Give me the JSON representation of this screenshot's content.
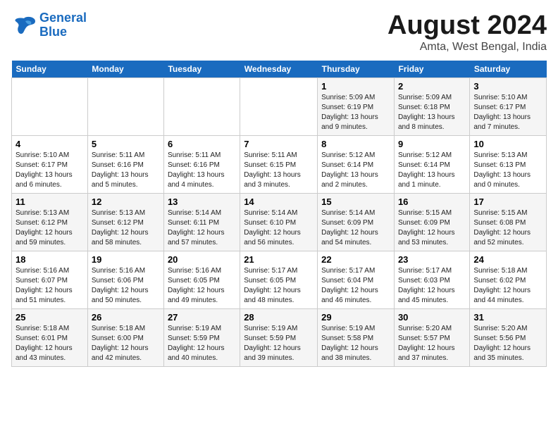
{
  "logo": {
    "line1": "General",
    "line2": "Blue"
  },
  "title": "August 2024",
  "subtitle": "Amta, West Bengal, India",
  "days_of_week": [
    "Sunday",
    "Monday",
    "Tuesday",
    "Wednesday",
    "Thursday",
    "Friday",
    "Saturday"
  ],
  "weeks": [
    [
      {
        "day": "",
        "info": ""
      },
      {
        "day": "",
        "info": ""
      },
      {
        "day": "",
        "info": ""
      },
      {
        "day": "",
        "info": ""
      },
      {
        "day": "1",
        "info": "Sunrise: 5:09 AM\nSunset: 6:19 PM\nDaylight: 13 hours\nand 9 minutes."
      },
      {
        "day": "2",
        "info": "Sunrise: 5:09 AM\nSunset: 6:18 PM\nDaylight: 13 hours\nand 8 minutes."
      },
      {
        "day": "3",
        "info": "Sunrise: 5:10 AM\nSunset: 6:17 PM\nDaylight: 13 hours\nand 7 minutes."
      }
    ],
    [
      {
        "day": "4",
        "info": "Sunrise: 5:10 AM\nSunset: 6:17 PM\nDaylight: 13 hours\nand 6 minutes."
      },
      {
        "day": "5",
        "info": "Sunrise: 5:11 AM\nSunset: 6:16 PM\nDaylight: 13 hours\nand 5 minutes."
      },
      {
        "day": "6",
        "info": "Sunrise: 5:11 AM\nSunset: 6:16 PM\nDaylight: 13 hours\nand 4 minutes."
      },
      {
        "day": "7",
        "info": "Sunrise: 5:11 AM\nSunset: 6:15 PM\nDaylight: 13 hours\nand 3 minutes."
      },
      {
        "day": "8",
        "info": "Sunrise: 5:12 AM\nSunset: 6:14 PM\nDaylight: 13 hours\nand 2 minutes."
      },
      {
        "day": "9",
        "info": "Sunrise: 5:12 AM\nSunset: 6:14 PM\nDaylight: 13 hours\nand 1 minute."
      },
      {
        "day": "10",
        "info": "Sunrise: 5:13 AM\nSunset: 6:13 PM\nDaylight: 13 hours\nand 0 minutes."
      }
    ],
    [
      {
        "day": "11",
        "info": "Sunrise: 5:13 AM\nSunset: 6:12 PM\nDaylight: 12 hours\nand 59 minutes."
      },
      {
        "day": "12",
        "info": "Sunrise: 5:13 AM\nSunset: 6:12 PM\nDaylight: 12 hours\nand 58 minutes."
      },
      {
        "day": "13",
        "info": "Sunrise: 5:14 AM\nSunset: 6:11 PM\nDaylight: 12 hours\nand 57 minutes."
      },
      {
        "day": "14",
        "info": "Sunrise: 5:14 AM\nSunset: 6:10 PM\nDaylight: 12 hours\nand 56 minutes."
      },
      {
        "day": "15",
        "info": "Sunrise: 5:14 AM\nSunset: 6:09 PM\nDaylight: 12 hours\nand 54 minutes."
      },
      {
        "day": "16",
        "info": "Sunrise: 5:15 AM\nSunset: 6:09 PM\nDaylight: 12 hours\nand 53 minutes."
      },
      {
        "day": "17",
        "info": "Sunrise: 5:15 AM\nSunset: 6:08 PM\nDaylight: 12 hours\nand 52 minutes."
      }
    ],
    [
      {
        "day": "18",
        "info": "Sunrise: 5:16 AM\nSunset: 6:07 PM\nDaylight: 12 hours\nand 51 minutes."
      },
      {
        "day": "19",
        "info": "Sunrise: 5:16 AM\nSunset: 6:06 PM\nDaylight: 12 hours\nand 50 minutes."
      },
      {
        "day": "20",
        "info": "Sunrise: 5:16 AM\nSunset: 6:05 PM\nDaylight: 12 hours\nand 49 minutes."
      },
      {
        "day": "21",
        "info": "Sunrise: 5:17 AM\nSunset: 6:05 PM\nDaylight: 12 hours\nand 48 minutes."
      },
      {
        "day": "22",
        "info": "Sunrise: 5:17 AM\nSunset: 6:04 PM\nDaylight: 12 hours\nand 46 minutes."
      },
      {
        "day": "23",
        "info": "Sunrise: 5:17 AM\nSunset: 6:03 PM\nDaylight: 12 hours\nand 45 minutes."
      },
      {
        "day": "24",
        "info": "Sunrise: 5:18 AM\nSunset: 6:02 PM\nDaylight: 12 hours\nand 44 minutes."
      }
    ],
    [
      {
        "day": "25",
        "info": "Sunrise: 5:18 AM\nSunset: 6:01 PM\nDaylight: 12 hours\nand 43 minutes."
      },
      {
        "day": "26",
        "info": "Sunrise: 5:18 AM\nSunset: 6:00 PM\nDaylight: 12 hours\nand 42 minutes."
      },
      {
        "day": "27",
        "info": "Sunrise: 5:19 AM\nSunset: 5:59 PM\nDaylight: 12 hours\nand 40 minutes."
      },
      {
        "day": "28",
        "info": "Sunrise: 5:19 AM\nSunset: 5:59 PM\nDaylight: 12 hours\nand 39 minutes."
      },
      {
        "day": "29",
        "info": "Sunrise: 5:19 AM\nSunset: 5:58 PM\nDaylight: 12 hours\nand 38 minutes."
      },
      {
        "day": "30",
        "info": "Sunrise: 5:20 AM\nSunset: 5:57 PM\nDaylight: 12 hours\nand 37 minutes."
      },
      {
        "day": "31",
        "info": "Sunrise: 5:20 AM\nSunset: 5:56 PM\nDaylight: 12 hours\nand 35 minutes."
      }
    ]
  ]
}
